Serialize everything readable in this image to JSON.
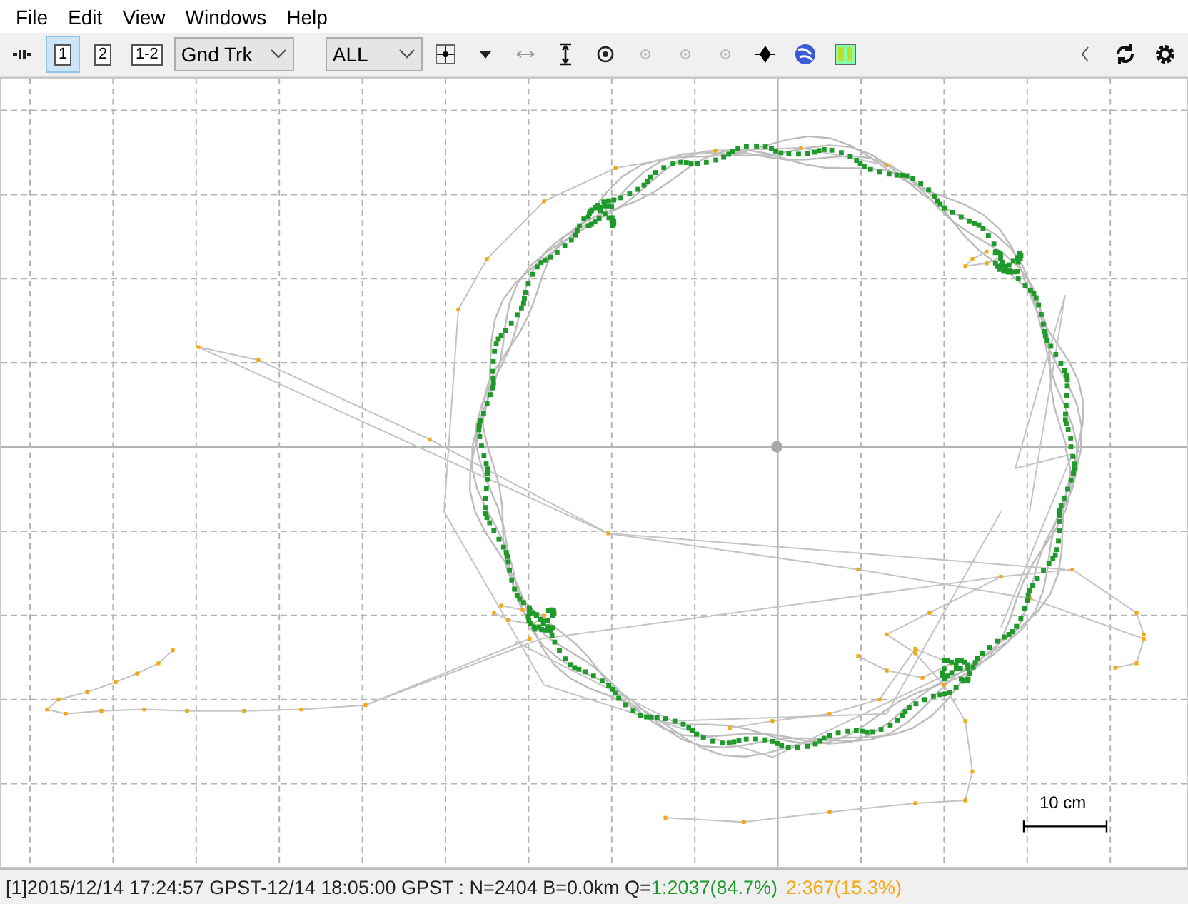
{
  "menu": [
    {
      "label": "File"
    },
    {
      "label": "Edit"
    },
    {
      "label": "View"
    },
    {
      "label": "Windows"
    },
    {
      "label": "Help"
    }
  ],
  "toolbar": {
    "solutions": [
      {
        "label": "1",
        "selected": true
      },
      {
        "label": "2",
        "selected": false
      },
      {
        "label": "1-2",
        "selected": false
      }
    ],
    "plot_type": {
      "value": "Gnd Trk"
    },
    "quality_filter": {
      "value": "ALL"
    }
  },
  "plot": {
    "scale_label": "10 cm"
  },
  "status_bar": {
    "text": "[1]2015/12/14 17:24:57 GPST-12/14 18:05:00 GPST : N=2404 B=0.0km Q=",
    "quality": [
      {
        "label": "1:2037(84.7%)",
        "color": "#1f9a2a"
      },
      {
        "label": "2:367(15.3%)",
        "color": "#f5a70f"
      }
    ]
  }
}
